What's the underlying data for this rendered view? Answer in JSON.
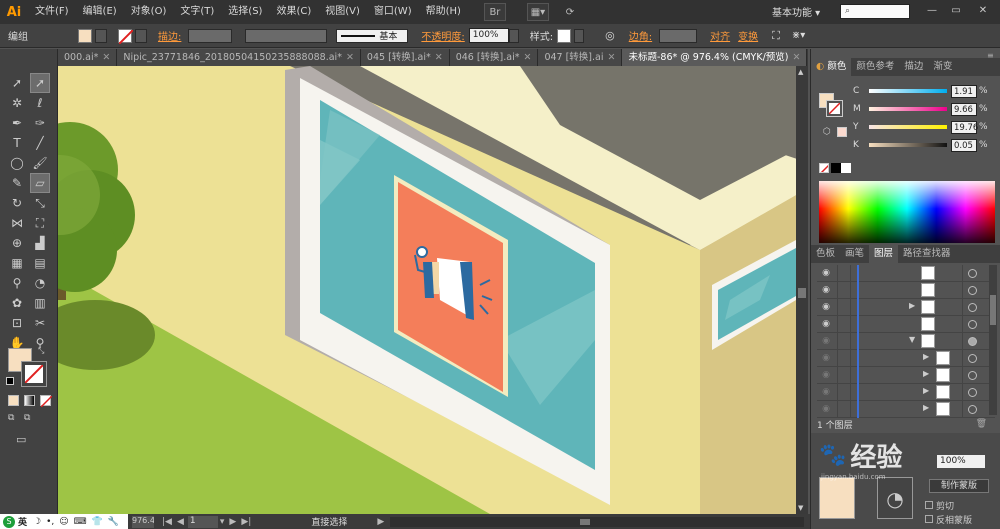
{
  "app": {
    "logo": "Ai"
  },
  "menu": [
    "文件(F)",
    "编辑(E)",
    "对象(O)",
    "文字(T)",
    "选择(S)",
    "效果(C)",
    "视图(V)",
    "窗口(W)",
    "帮助(H)"
  ],
  "menubar": {
    "workspace": "基本功能",
    "search_placeholder": ""
  },
  "controlbar": {
    "selection_label": "编组",
    "stroke_label": "描边:",
    "stroke_style": "基本",
    "opacity_label": "不透明度:",
    "opacity_value": "100%",
    "style_label": "样式:",
    "corner_label": "边角:",
    "align_label": "对齐",
    "transform_label": "变换",
    "fill_color": "#f7dfc0"
  },
  "tabs": [
    {
      "label": "000.ai*",
      "active": false
    },
    {
      "label": "Nipic_23771846_20180504150235888088.ai*",
      "active": false
    },
    {
      "label": "045 [转换].ai*",
      "active": false
    },
    {
      "label": "046 [转换].ai*",
      "active": false
    },
    {
      "label": "047 [转换].ai",
      "active": false
    },
    {
      "label": "未标题-86* @ 976.4% (CMYK/预览)",
      "active": true
    }
  ],
  "color_panel": {
    "tabs": [
      "颜色",
      "颜色参考",
      "描边",
      "渐变"
    ],
    "sliders": [
      {
        "channel": "C",
        "value": "1.91",
        "level": 0.02
      },
      {
        "channel": "M",
        "value": "9.66",
        "level": 0.1
      },
      {
        "channel": "Y",
        "value": "19.76",
        "level": 0.2
      },
      {
        "channel": "K",
        "value": "0.05",
        "level": 0.0
      }
    ],
    "pct": "%"
  },
  "layers_panel": {
    "tabs": [
      "色板",
      "画笔",
      "图层",
      "路径查找器"
    ],
    "footer_text": "1 个图层"
  },
  "lower_panel": {
    "opacity_value": "100%",
    "make_mask": "制作蒙版",
    "clip": "剪切",
    "invert_mask": "反相蒙版"
  },
  "statusbar": {
    "zoom": "976.4%",
    "page": "1",
    "tool": "直接选择"
  },
  "watermark": {
    "text": "经验",
    "sub": "jingyan.baidu.com"
  },
  "ime": {
    "label": "英"
  },
  "colors": {
    "accent_orange": "#ff9a3b",
    "wall_yellow": "#ede195",
    "wall_light": "#f5f0c9",
    "window_teal": "#5fb5b9",
    "poster_orange": "#f47e5a",
    "grass_green": "#9ec445",
    "tree_green": "#5e8e23",
    "roof_gray": "#76746a"
  }
}
